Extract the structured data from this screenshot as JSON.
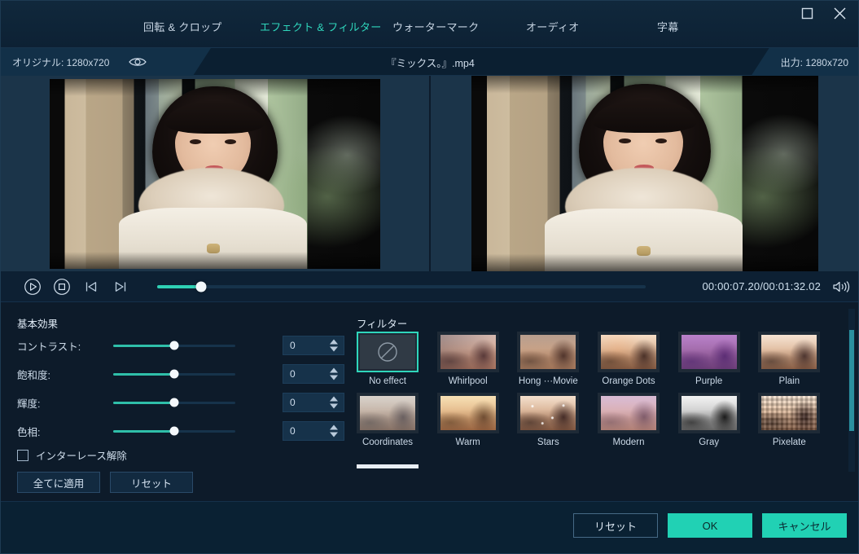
{
  "window": {
    "maximize_label": "maximize",
    "close_label": "close"
  },
  "tabs": [
    {
      "label": "回転 & クロップ",
      "active": false
    },
    {
      "label": "エフェクト & フィルター",
      "active": true
    },
    {
      "label": "ウォーターマーク",
      "active": false
    },
    {
      "label": "オーディオ",
      "active": false
    },
    {
      "label": "字幕",
      "active": false
    }
  ],
  "infobar": {
    "original": "オリジナル: 1280x720",
    "filename": "『ミックス。』.mp4",
    "output": "出力: 1280x720"
  },
  "transport": {
    "play_label": "play",
    "stop_label": "stop",
    "prev_label": "previous-frame",
    "next_label": "next-frame",
    "progress_percent": 9,
    "timecode": "00:00:07.20/00:01:32.02",
    "volume_label": "volume"
  },
  "basic": {
    "title": "基本効果",
    "rows": [
      {
        "label": "コントラスト:",
        "value": "0",
        "slider_percent": 50
      },
      {
        "label": "飽和度:",
        "value": "0",
        "slider_percent": 50
      },
      {
        "label": "輝度:",
        "value": "0",
        "slider_percent": 50
      },
      {
        "label": "色相:",
        "value": "0",
        "slider_percent": 50
      }
    ],
    "deinterlace_label": "インターレース解除",
    "deinterlace_checked": false,
    "apply_all_label": "全てに適用",
    "reset_label": "リセット"
  },
  "filter": {
    "title": "フィルター",
    "selected_index": 0,
    "items": [
      {
        "label": "No effect",
        "tone": "none"
      },
      {
        "label": "Whirlpool",
        "tone": "whirlpool"
      },
      {
        "label": "Hong ···Movie",
        "tone": "hongmovie"
      },
      {
        "label": "Orange Dots",
        "tone": "orangedots"
      },
      {
        "label": "Purple",
        "tone": "purple"
      },
      {
        "label": "Plain",
        "tone": "plain"
      },
      {
        "label": "Coordinates",
        "tone": "coordinates"
      },
      {
        "label": "Warm",
        "tone": "warm"
      },
      {
        "label": "Stars",
        "tone": "stars"
      },
      {
        "label": "Modern",
        "tone": "modern"
      },
      {
        "label": "Gray",
        "tone": "gray"
      },
      {
        "label": "Pixelate",
        "tone": "pixelate"
      }
    ]
  },
  "footer": {
    "reset_label": "リセット",
    "ok_label": "OK",
    "cancel_label": "キャンセル"
  },
  "colors": {
    "accent": "#21d1b4",
    "accent_tab": "#2fd6bb",
    "slider": "#2fbfa9",
    "panel_bg": "#0d1b2a",
    "preview_bg": "#1b3449"
  }
}
